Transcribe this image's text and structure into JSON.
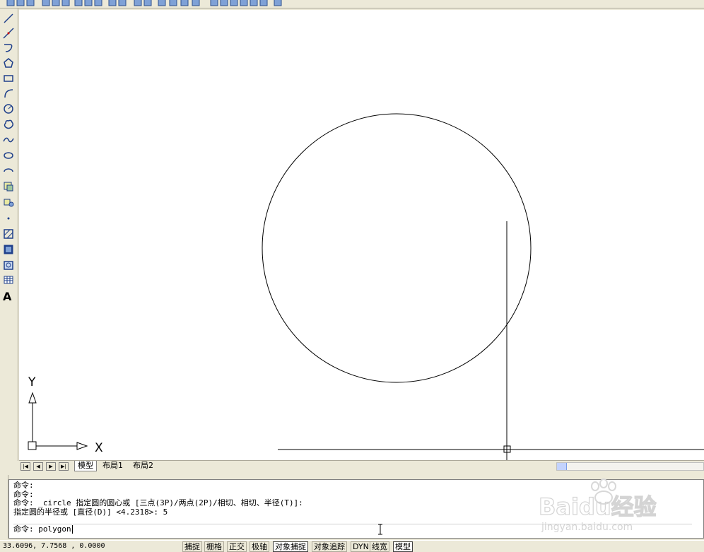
{
  "toolbar_top": {
    "icons": [
      "new-icon",
      "open-icon",
      "save-icon",
      "plot-icon",
      "preview-icon",
      "publish-icon",
      "cut-icon",
      "copy-icon",
      "paste-icon",
      "match-icon",
      "brush-icon",
      "undo-icon",
      "redo-icon",
      "pan-icon",
      "zoom-realtime-icon",
      "zoom-window-icon",
      "zoom-previous-icon",
      "properties-icon",
      "designcenter-icon",
      "toolpalette-icon",
      "sheetset-icon",
      "markup-icon",
      "calc-icon",
      "help-icon"
    ]
  },
  "toolbar_left": {
    "icons": [
      "line-icon",
      "construction-line-icon",
      "polyline-icon",
      "polygon-icon",
      "rectangle-icon",
      "arc-icon",
      "circle-icon",
      "revision-cloud-icon",
      "spline-icon",
      "ellipse-icon",
      "ellipse-arc-icon",
      "insert-block-icon",
      "make-block-icon",
      "point-icon",
      "hatch-icon",
      "gradient-icon",
      "region-icon",
      "table-icon",
      "multiline-text-icon"
    ],
    "text_tool_label": "A"
  },
  "ucs": {
    "x_label": "X",
    "y_label": "Y"
  },
  "layout_tabs": {
    "nav_buttons": [
      "|◀",
      "◀",
      "▶",
      "▶|"
    ],
    "tabs": [
      {
        "label": "模型",
        "active": true
      },
      {
        "label": "布局1",
        "active": false
      },
      {
        "label": "布局2",
        "active": false
      }
    ]
  },
  "command_window": {
    "history": [
      "命令:",
      "命令:",
      "命令: _circle 指定圆的圆心或 [三点(3P)/两点(2P)/相切、相切、半径(T)]:",
      "指定圆的半径或 [直径(D)] <4.2318>: 5"
    ],
    "input": "命令: polygon"
  },
  "status_bar": {
    "coordinates": "33.6096, 7.7568 , 0.0000",
    "buttons": [
      {
        "label": "捕捉",
        "on": false
      },
      {
        "label": "栅格",
        "on": false
      },
      {
        "label": "正交",
        "on": false
      },
      {
        "label": "极轴",
        "on": false
      },
      {
        "label": "对象捕捉",
        "on": true
      },
      {
        "label": "对象追踪",
        "on": false
      },
      {
        "label": "DYN",
        "on": false
      },
      {
        "label": "线宽",
        "on": false
      },
      {
        "label": "模型",
        "on": true
      }
    ]
  },
  "watermark": {
    "brand": "Baidu经验",
    "url": "jingyan.baidu.com"
  },
  "colors": {
    "chrome": "#ece9d8",
    "canvas": "#ffffff",
    "entity": "#000000"
  }
}
